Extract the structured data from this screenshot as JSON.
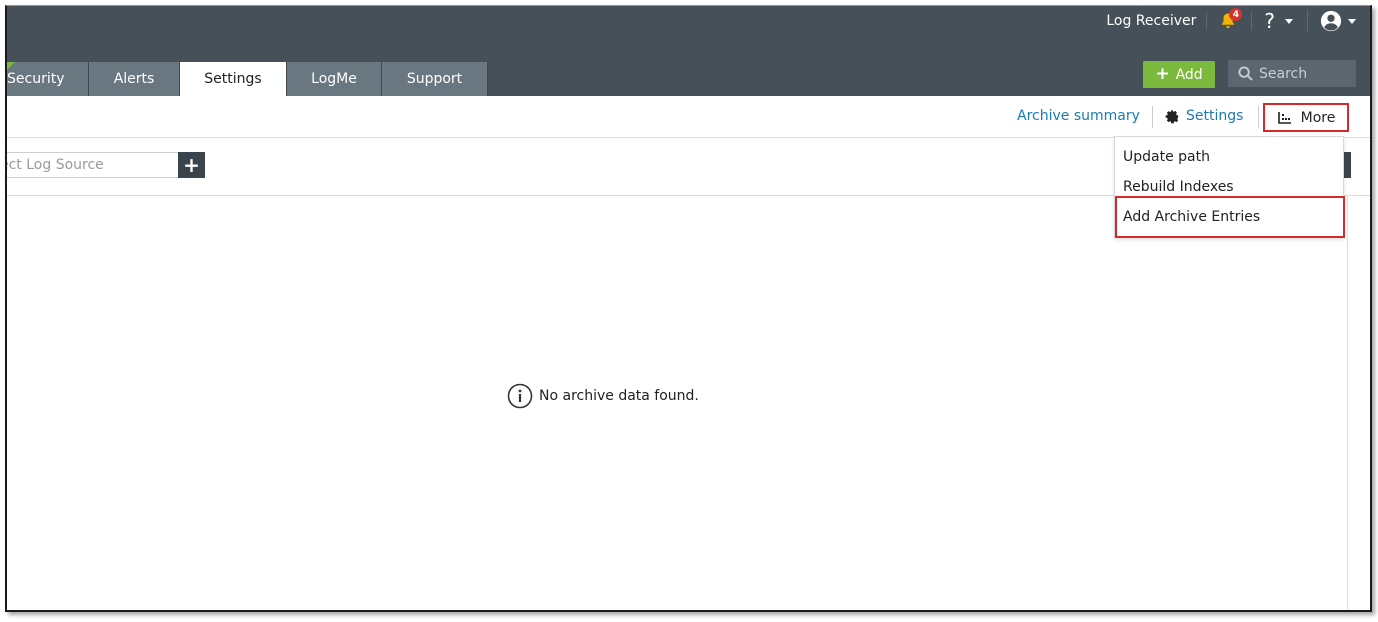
{
  "header": {
    "user_label": "Log Receiver",
    "notification_count": "4",
    "help_label": "?"
  },
  "tabs": [
    {
      "label": "Security",
      "active": false
    },
    {
      "label": "Alerts",
      "active": false
    },
    {
      "label": "Settings",
      "active": true
    },
    {
      "label": "LogMe",
      "active": false
    },
    {
      "label": "Support",
      "active": false
    }
  ],
  "actions": {
    "add_label": "Add",
    "search_placeholder": "Search"
  },
  "toolbar": {
    "archive_summary": "Archive summary",
    "settings": "Settings",
    "more": "More"
  },
  "filter": {
    "source_placeholder": "ect Log Source",
    "add_symbol": "+"
  },
  "more_menu": {
    "items": [
      "Update path",
      "Rebuild Indexes",
      "Add Archive Entries"
    ]
  },
  "main": {
    "empty_message": "No archive data found."
  },
  "colors": {
    "header_bg": "#455059",
    "tab_bg": "#697780",
    "accent_green": "#7cba3d",
    "link_blue": "#1a7bb5",
    "highlight_red": "#d42a2a",
    "badge_red": "#d9342b",
    "bell_yellow": "#f0b400"
  }
}
